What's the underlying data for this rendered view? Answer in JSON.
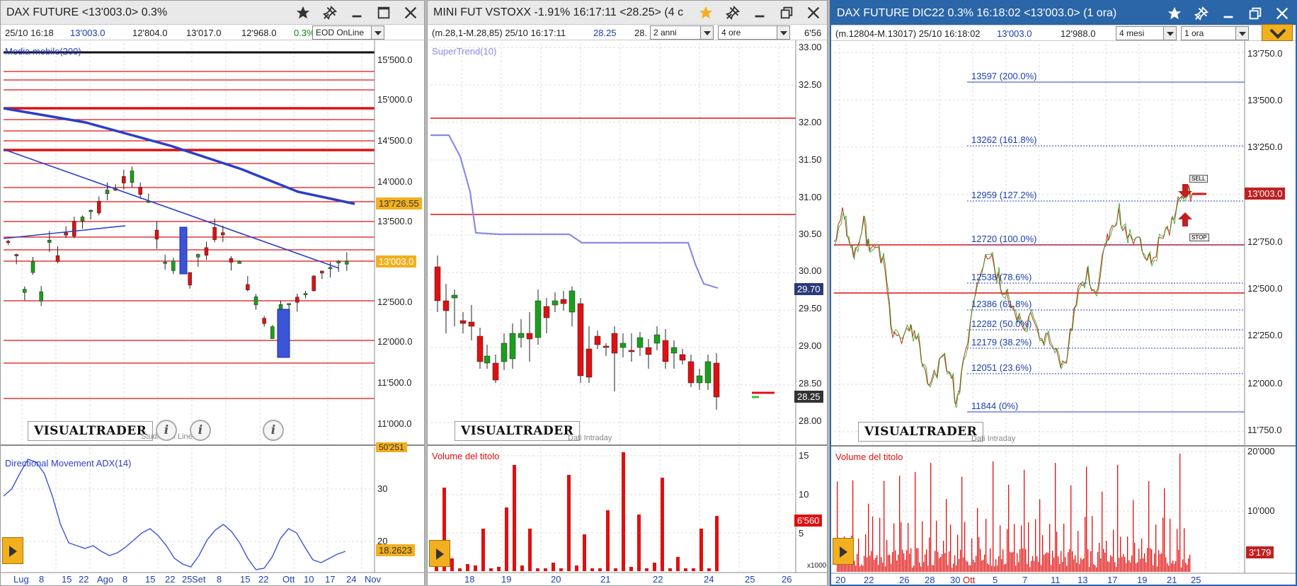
{
  "windows": [
    {
      "title": "DAX FUTURE <13'003.0> 0.3%",
      "info": {
        "date": "25/10 16:18",
        "last": "13'003.0",
        "open": "12'804.0",
        "high": "13'017.0",
        "low": "12'968.0",
        "change": "0.3%",
        "feed": "EOD OnLine"
      },
      "indicator_top": "Media mobile(200)",
      "price_tags": {
        "ma": "13'726.55",
        "last": "13'003.0"
      },
      "yaxis": [
        "15'500.0",
        "15'000.0",
        "14'500.0",
        "14'000.0",
        "13'500.0",
        "13'000.0",
        "12'500.0",
        "12'000.0",
        "11'500.0",
        "11'000.0"
      ],
      "logo": "VISUALTRADER",
      "watermark": "Studio On Line",
      "info_icon": "i",
      "volume_tag": "50'251",
      "indicator_bottom": "Directional Movement ADX(14)",
      "adx_axis": [
        "30",
        "20"
      ],
      "adx_value": "18.2623",
      "xaxis": [
        "Lug",
        "8",
        "15",
        "22",
        "Ago",
        "8",
        "15",
        "22",
        "25",
        "Set",
        "8",
        "15",
        "22",
        "Ott",
        "10",
        "17",
        "24",
        "Nov"
      ]
    },
    {
      "title": "MINI FUT VSTOXX -1.91% 16:17:11 <28.25> (4 c",
      "info": {
        "label": "(m.28,1-M.28,85) 25/10 16:17:11",
        "last": "28.25",
        "extra": "28.",
        "period": "2 anni",
        "timeframe": "4 ore",
        "edge": "6'56"
      },
      "indicator_top": "SuperTrend(10)",
      "yaxis": [
        "33.00",
        "32.50",
        "32.00",
        "31.50",
        "31.00",
        "30.50",
        "30.00",
        "29.50",
        "29.00",
        "28.50",
        "28.00"
      ],
      "price_tags": {
        "supertrend": "29.70",
        "last": "28.25"
      },
      "logo": "VISUALTRADER",
      "caption": "Dati Intraday",
      "indicator_bottom": "Volume del titolo",
      "vol_axis": [
        "15",
        "10",
        "5"
      ],
      "vol_value": "6'560",
      "vol_unit": "x1000",
      "xaxis": [
        "18",
        "19",
        "20",
        "21",
        "22",
        "24",
        "25",
        "26"
      ]
    },
    {
      "title": "DAX FUTURE DIC22 0.3% 16:18:02 <13'003.0> (1 ora)",
      "info": {
        "label": "(m.12804-M.13017) 25/10 16:18:02",
        "last": "13'003.0",
        "extra": "12'988.0",
        "period": "4 mesi",
        "timeframe": "1 ora"
      },
      "fib_levels": [
        "13597 (200.0%)",
        "13262 (161.8%)",
        "12959 (127.2%)",
        "12720 (100.0%)",
        "12538 (78.6%)",
        "12386 (61.8%)",
        "12282 (50.0%)",
        "12179 (38.2%)",
        "12051 (23.6%)",
        "11844 (0%)"
      ],
      "yaxis": [
        "13'750.0",
        "13'500.0",
        "13'250.0",
        "13'000.0",
        "12'750.0",
        "12'500.0",
        "12'250.0",
        "12'000.0",
        "11'750.0"
      ],
      "price_tags": {
        "last": "13'003.0"
      },
      "signals": {
        "sell": "SELL",
        "stop": "STOP"
      },
      "logo": "VISUALTRADER",
      "caption": "Dati Intraday",
      "indicator_bottom": "Volume del titolo",
      "vol_axis": [
        "20'000",
        "10'000"
      ],
      "vol_value": "3'179",
      "xaxis": [
        "20",
        "22",
        "26",
        "28",
        "30",
        "Ott",
        "5",
        "7",
        "11",
        "13",
        "17",
        "19",
        "21",
        "25"
      ]
    }
  ],
  "colors": {
    "accent_blue": "#2a66a8",
    "red": "#e01010",
    "orange": "#f2b01e",
    "ma_blue": "#2a3fc9"
  }
}
